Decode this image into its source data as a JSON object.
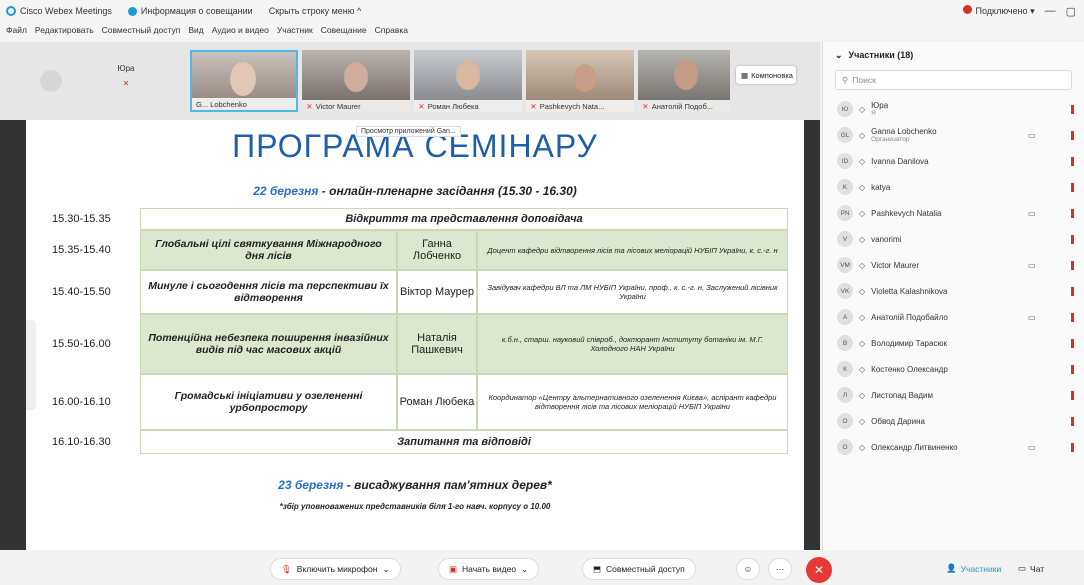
{
  "titlebar": {
    "app_title": "Cisco Webex Meetings",
    "info_label": "Информация о совещании",
    "hide_menu_label": "Скрыть строку меню ^",
    "connection_label": "Подключено",
    "win_min": "—",
    "win_max": "▢"
  },
  "menu": [
    "Файл",
    "Редактировать",
    "Совместный доступ",
    "Вид",
    "Аудио и видео",
    "Участник",
    "Совещание",
    "Справка"
  ],
  "strip": {
    "self_name": "Юра",
    "tiles": [
      {
        "label": "G... Lobchenko"
      },
      {
        "label": "Victor Maurer"
      },
      {
        "label": "Роман Любека"
      },
      {
        "label": "Pashkevych Nata..."
      },
      {
        "label": "Анатолій Подоб..."
      }
    ],
    "layout_label": "Компоновка"
  },
  "slide": {
    "tooltip": "Просмотр приложений Gan...",
    "title": "ПРОГРАМА СЕМІНАРУ",
    "day1_date": "22 березня",
    "day1_text": " - онлайн-пленарне засідання (15.30 - 16.30)",
    "rows": [
      {
        "time": "15.30-15.35",
        "span": "Відкриття та представлення доповідача"
      },
      {
        "time": "15.35-15.40",
        "topic": "Глобальні цілі святкування Міжнародного дня лісів",
        "name": "Ганна Лобченко",
        "desc": "Доцент кафедри відтворення лісів та лісових меліорацій НУБІП України, к. с.-г. н"
      },
      {
        "time": "15.40-15.50",
        "topic": "Минуле і сьогодення лісів та перспективи їх відтворення",
        "name": "Віктор Маурер",
        "desc": "Завідувач кафедри ВЛ та ЛМ НУБІП України, проф., к. с.-г. н, Заслужений лісівник України"
      },
      {
        "time": "15.50-16.00",
        "topic": "Потенційна небезпека поширення інвазійних видів під час масових акцій",
        "name": "Наталія Пашкевич",
        "desc": "к.б.н., старш. науковий співроб., докторант Інституту ботаніки ім. М.Г. Холодного НАН України"
      },
      {
        "time": "16.00-16.10",
        "topic": "Громадські ініціативи у озелененні урбопростору",
        "name": "Роман Любека",
        "desc": "Координатор «Центру альтернативного озеленення Києва», аспірант кафедри відтворення лісів та лісових меліорацій НУБІП України"
      },
      {
        "time": "16.10-16.30",
        "span": "Запитання та відповіді"
      }
    ],
    "day2_date": "23 березня",
    "day2_text": " - висаджування пам'ятних дерев*",
    "note": "*збір уповноважених представників біля 1-го навч. корпусу о 10.00"
  },
  "panel": {
    "header": "Участники (18)",
    "search_placeholder": "Поиск",
    "participants": [
      {
        "initials": "Ю",
        "name": "Юра",
        "sub": "Я",
        "cam": false
      },
      {
        "initials": "GL",
        "name": "Ganna Lobchenko",
        "sub": "Организатор",
        "cam": true
      },
      {
        "initials": "ID",
        "name": "Ivanna Danilova",
        "sub": "",
        "cam": false
      },
      {
        "initials": "K",
        "name": "katya",
        "sub": "",
        "cam": false
      },
      {
        "initials": "PN",
        "name": "Pashkevych Natalia",
        "sub": "",
        "cam": true
      },
      {
        "initials": "V",
        "name": "vanorimi",
        "sub": "",
        "cam": false
      },
      {
        "initials": "VM",
        "name": "Victor Maurer",
        "sub": "",
        "cam": true
      },
      {
        "initials": "VK",
        "name": "Violetta Kalashnikova",
        "sub": "",
        "cam": false
      },
      {
        "initials": "А",
        "name": "Анатолій Подобайло",
        "sub": "",
        "cam": true
      },
      {
        "initials": "В",
        "name": "Володимир Тарасюк",
        "sub": "",
        "cam": false
      },
      {
        "initials": "К",
        "name": "Костенко Олександр",
        "sub": "",
        "cam": false
      },
      {
        "initials": "Л",
        "name": "Листопад Вадим",
        "sub": "",
        "cam": false
      },
      {
        "initials": "О",
        "name": "Обвод Дарина",
        "sub": "",
        "cam": false
      },
      {
        "initials": "О",
        "name": "Олександр Литвиненко",
        "sub": "",
        "cam": true
      }
    ]
  },
  "controls": {
    "mic": "Включить микрофон",
    "video": "Начать видео",
    "share": "Совместный доступ",
    "participants": "Участники",
    "chat": "Чат"
  },
  "colors": {
    "accent": "#1f5fa8",
    "leave": "#e53935",
    "green_row": "#dbe7cf"
  }
}
